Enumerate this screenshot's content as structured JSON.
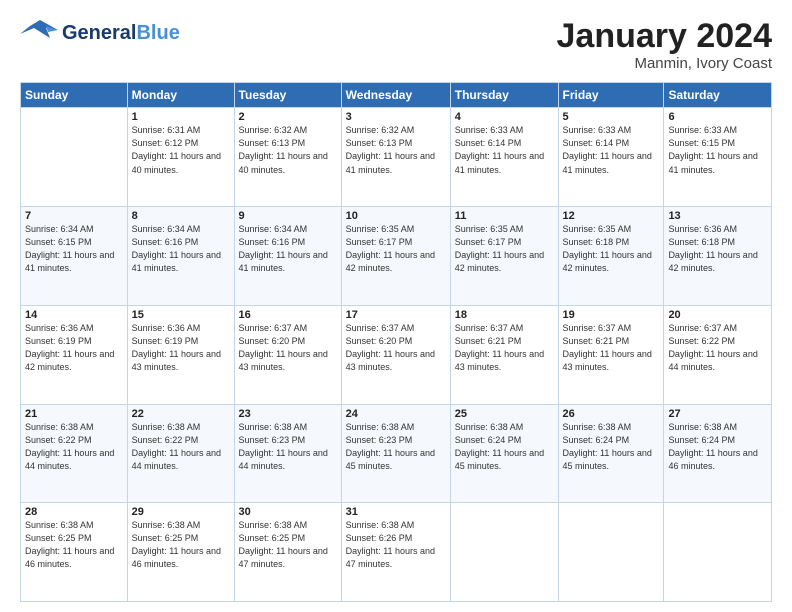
{
  "header": {
    "logo_line1": "General",
    "logo_line2": "Blue",
    "title": "January 2024",
    "location": "Manmin, Ivory Coast"
  },
  "days_of_week": [
    "Sunday",
    "Monday",
    "Tuesday",
    "Wednesday",
    "Thursday",
    "Friday",
    "Saturday"
  ],
  "weeks": [
    [
      {
        "day": "",
        "sunrise": "",
        "sunset": "",
        "daylight": ""
      },
      {
        "day": "1",
        "sunrise": "6:31 AM",
        "sunset": "6:12 PM",
        "daylight": "11 hours and 40 minutes."
      },
      {
        "day": "2",
        "sunrise": "6:32 AM",
        "sunset": "6:13 PM",
        "daylight": "11 hours and 40 minutes."
      },
      {
        "day": "3",
        "sunrise": "6:32 AM",
        "sunset": "6:13 PM",
        "daylight": "11 hours and 41 minutes."
      },
      {
        "day": "4",
        "sunrise": "6:33 AM",
        "sunset": "6:14 PM",
        "daylight": "11 hours and 41 minutes."
      },
      {
        "day": "5",
        "sunrise": "6:33 AM",
        "sunset": "6:14 PM",
        "daylight": "11 hours and 41 minutes."
      },
      {
        "day": "6",
        "sunrise": "6:33 AM",
        "sunset": "6:15 PM",
        "daylight": "11 hours and 41 minutes."
      }
    ],
    [
      {
        "day": "7",
        "sunrise": "6:34 AM",
        "sunset": "6:15 PM",
        "daylight": "11 hours and 41 minutes."
      },
      {
        "day": "8",
        "sunrise": "6:34 AM",
        "sunset": "6:16 PM",
        "daylight": "11 hours and 41 minutes."
      },
      {
        "day": "9",
        "sunrise": "6:34 AM",
        "sunset": "6:16 PM",
        "daylight": "11 hours and 41 minutes."
      },
      {
        "day": "10",
        "sunrise": "6:35 AM",
        "sunset": "6:17 PM",
        "daylight": "11 hours and 42 minutes."
      },
      {
        "day": "11",
        "sunrise": "6:35 AM",
        "sunset": "6:17 PM",
        "daylight": "11 hours and 42 minutes."
      },
      {
        "day": "12",
        "sunrise": "6:35 AM",
        "sunset": "6:18 PM",
        "daylight": "11 hours and 42 minutes."
      },
      {
        "day": "13",
        "sunrise": "6:36 AM",
        "sunset": "6:18 PM",
        "daylight": "11 hours and 42 minutes."
      }
    ],
    [
      {
        "day": "14",
        "sunrise": "6:36 AM",
        "sunset": "6:19 PM",
        "daylight": "11 hours and 42 minutes."
      },
      {
        "day": "15",
        "sunrise": "6:36 AM",
        "sunset": "6:19 PM",
        "daylight": "11 hours and 43 minutes."
      },
      {
        "day": "16",
        "sunrise": "6:37 AM",
        "sunset": "6:20 PM",
        "daylight": "11 hours and 43 minutes."
      },
      {
        "day": "17",
        "sunrise": "6:37 AM",
        "sunset": "6:20 PM",
        "daylight": "11 hours and 43 minutes."
      },
      {
        "day": "18",
        "sunrise": "6:37 AM",
        "sunset": "6:21 PM",
        "daylight": "11 hours and 43 minutes."
      },
      {
        "day": "19",
        "sunrise": "6:37 AM",
        "sunset": "6:21 PM",
        "daylight": "11 hours and 43 minutes."
      },
      {
        "day": "20",
        "sunrise": "6:37 AM",
        "sunset": "6:22 PM",
        "daylight": "11 hours and 44 minutes."
      }
    ],
    [
      {
        "day": "21",
        "sunrise": "6:38 AM",
        "sunset": "6:22 PM",
        "daylight": "11 hours and 44 minutes."
      },
      {
        "day": "22",
        "sunrise": "6:38 AM",
        "sunset": "6:22 PM",
        "daylight": "11 hours and 44 minutes."
      },
      {
        "day": "23",
        "sunrise": "6:38 AM",
        "sunset": "6:23 PM",
        "daylight": "11 hours and 44 minutes."
      },
      {
        "day": "24",
        "sunrise": "6:38 AM",
        "sunset": "6:23 PM",
        "daylight": "11 hours and 45 minutes."
      },
      {
        "day": "25",
        "sunrise": "6:38 AM",
        "sunset": "6:24 PM",
        "daylight": "11 hours and 45 minutes."
      },
      {
        "day": "26",
        "sunrise": "6:38 AM",
        "sunset": "6:24 PM",
        "daylight": "11 hours and 45 minutes."
      },
      {
        "day": "27",
        "sunrise": "6:38 AM",
        "sunset": "6:24 PM",
        "daylight": "11 hours and 46 minutes."
      }
    ],
    [
      {
        "day": "28",
        "sunrise": "6:38 AM",
        "sunset": "6:25 PM",
        "daylight": "11 hours and 46 minutes."
      },
      {
        "day": "29",
        "sunrise": "6:38 AM",
        "sunset": "6:25 PM",
        "daylight": "11 hours and 46 minutes."
      },
      {
        "day": "30",
        "sunrise": "6:38 AM",
        "sunset": "6:25 PM",
        "daylight": "11 hours and 47 minutes."
      },
      {
        "day": "31",
        "sunrise": "6:38 AM",
        "sunset": "6:26 PM",
        "daylight": "11 hours and 47 minutes."
      },
      {
        "day": "",
        "sunrise": "",
        "sunset": "",
        "daylight": ""
      },
      {
        "day": "",
        "sunrise": "",
        "sunset": "",
        "daylight": ""
      },
      {
        "day": "",
        "sunrise": "",
        "sunset": "",
        "daylight": ""
      }
    ]
  ]
}
